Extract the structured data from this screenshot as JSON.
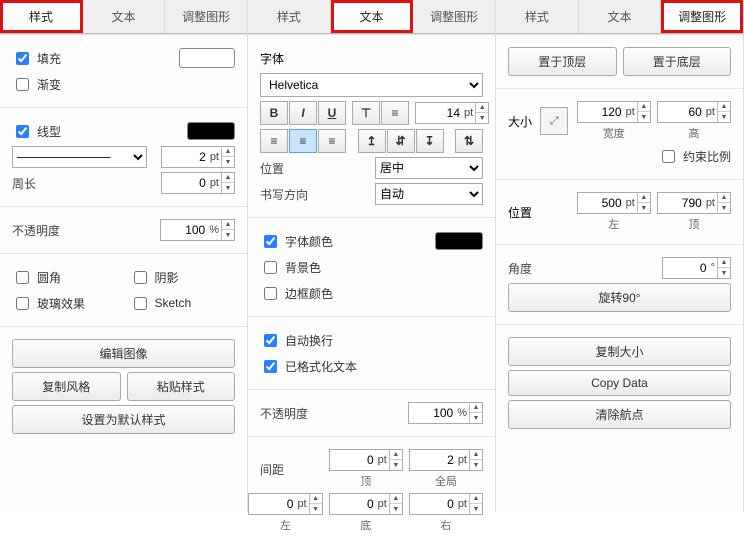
{
  "tabs": {
    "style": "样式",
    "text": "文本",
    "arrange": "调整图形"
  },
  "p1": {
    "fill": "填充",
    "gradient": "渐变",
    "line": "线型",
    "perimeter": "周长",
    "opacity": "不透明度",
    "rounded": "圆角",
    "shadow": "阴影",
    "glass": "玻璃效果",
    "sketch": "Sketch",
    "editImage": "编辑图像",
    "copyStyle": "复制风格",
    "pasteStyle": "粘贴样式",
    "setDefault": "设置为默认样式",
    "lineWidth": "2 pt",
    "lineWidthVal": "2",
    "perimeterVal": "0",
    "opacityVal": "100"
  },
  "p2": {
    "font": "字体",
    "fontName": "Helvetica",
    "fontSizeVal": "14",
    "position": "位置",
    "posValue": "居中",
    "writing": "书写方向",
    "writingValue": "自动",
    "fontColor": "字体颜色",
    "bgColor": "背景色",
    "borderColor": "边框颜色",
    "wrap": "自动换行",
    "formatted": "已格式化文本",
    "opacity": "不透明度",
    "opacityVal": "100",
    "spacing": "间距",
    "spTopVal": "0",
    "spGlobalVal": "2",
    "spLeftVal": "0",
    "spBottomVal": "0",
    "spRightVal": "0",
    "lblTop": "顶",
    "lblGlobal": "全局",
    "lblLeft": "左",
    "lblBottom": "底",
    "lblRight": "右",
    "b": "B",
    "i": "I",
    "u": "U"
  },
  "p3": {
    "toFront": "置于顶层",
    "toBack": "置于底层",
    "size": "大小",
    "width": "宽度",
    "height": "高",
    "wVal": "120",
    "hVal": "60",
    "constrain": "约束比例",
    "position": "位置",
    "left": "左",
    "top": "顶",
    "leftVal": "500",
    "topVal": "790",
    "angle": "角度",
    "angleVal": "0",
    "rotate90": "旋转90°",
    "copySize": "复制大小",
    "copyData": "Copy Data",
    "clearWaypoints": "清除航点"
  },
  "ptUnit": "pt",
  "pctUnit": "%",
  "degUnit": "°"
}
